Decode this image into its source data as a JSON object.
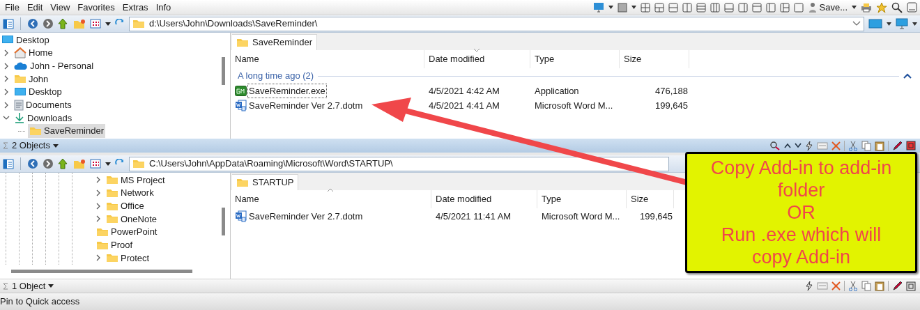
{
  "menu": [
    "File",
    "Edit",
    "View",
    "Favorites",
    "Extras",
    "Info"
  ],
  "toolbar_label": "Save...",
  "panes": [
    {
      "address": "d:\\Users\\John\\Downloads\\SaveReminder\\",
      "tab": "SaveReminder",
      "columns": [
        "Name",
        "Date modified",
        "Type",
        "Size"
      ],
      "group": "A long time ago (2)",
      "tree": [
        {
          "label": "Desktop",
          "kind": "desktop",
          "children": [
            {
              "label": "Home",
              "kind": "home",
              "expanded": false
            },
            {
              "label": "John - Personal",
              "kind": "cloud",
              "expanded": false
            },
            {
              "label": "John",
              "kind": "folder",
              "expanded": false
            },
            {
              "label": "Desktop",
              "kind": "desktop",
              "expanded": false
            },
            {
              "label": "Documents",
              "kind": "documents",
              "expanded": false
            },
            {
              "label": "Downloads",
              "kind": "downloads",
              "expanded": true,
              "children": [
                {
                  "label": "SaveReminder",
                  "kind": "folder",
                  "selected": true
                }
              ]
            }
          ]
        }
      ],
      "files": [
        {
          "name": "SaveReminder.exe",
          "kind": "exe",
          "date": "4/5/2021 4:42 AM",
          "type": "Application",
          "size": "476,188",
          "selected": true
        },
        {
          "name": "SaveReminder Ver 2.7.dotm",
          "kind": "word",
          "date": "4/5/2021 4:41 AM",
          "type": "Microsoft Word M...",
          "size": "199,645",
          "selected": false
        }
      ],
      "status": "2 Objects"
    },
    {
      "address": "C:\\Users\\John\\AppData\\Roaming\\Microsoft\\Word\\STARTUP\\",
      "tab": "STARTUP",
      "columns": [
        "Name",
        "Date modified",
        "Type",
        "Size"
      ],
      "tree": [
        {
          "label": "MS Project",
          "kind": "folder",
          "expanded": false
        },
        {
          "label": "Network",
          "kind": "folder",
          "expanded": false
        },
        {
          "label": "Office",
          "kind": "folder",
          "expanded": false
        },
        {
          "label": "OneNote",
          "kind": "folder",
          "expanded": false
        },
        {
          "label": "PowerPoint",
          "kind": "folder"
        },
        {
          "label": "Proof",
          "kind": "folder"
        },
        {
          "label": "Protect",
          "kind": "folder",
          "expanded": false
        }
      ],
      "files": [
        {
          "name": "SaveReminder Ver 2.7.dotm",
          "kind": "word",
          "date": "4/5/2021 11:41 AM",
          "type": "Microsoft Word M...",
          "size": "199,645",
          "selected": false
        }
      ],
      "status": "1 Object"
    }
  ],
  "bottom_bar": "Pin to Quick access",
  "callout": {
    "lines": [
      "Copy Add-in to add-in folder",
      "OR",
      "Run .exe which will copy Add-in"
    ]
  }
}
